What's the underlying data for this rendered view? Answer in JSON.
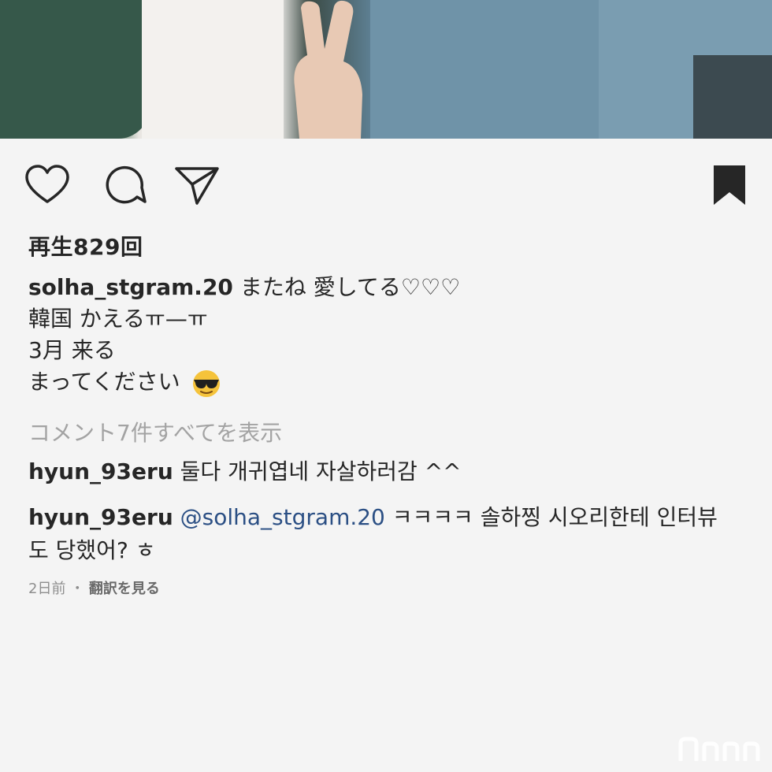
{
  "post": {
    "views": "再生829回",
    "caption": {
      "username": "solha_stgram.20",
      "lines": [
        "またね 愛してる♡♡♡",
        "韓国 かえるㅠ—ㅠ",
        "3月 来る",
        "まってください"
      ]
    },
    "view_all_comments": "コメント7件すべてを表示",
    "comments": [
      {
        "username": "hyun_93eru",
        "mention": "",
        "text": "둘다 개귀엽네 자살하러감 ^^"
      },
      {
        "username": "hyun_93eru",
        "mention": "@solha_stgram.20",
        "text": "ㅋㅋㅋㅋ 솔하찡 시오리한테 인터뷰도 당했어? ㅎ"
      }
    ],
    "time_ago": "2日前",
    "separator": "・",
    "translate_label": "翻訳を見る"
  },
  "icons": {
    "like": "heart-icon",
    "comment": "comment-icon",
    "share": "send-icon",
    "save": "bookmark-icon",
    "emoji": "sunglasses-face-emoji"
  },
  "colors": {
    "background": "#f4f4f4",
    "text": "#262626",
    "muted": "#a3a3a3",
    "mention": "#2b4f84"
  }
}
